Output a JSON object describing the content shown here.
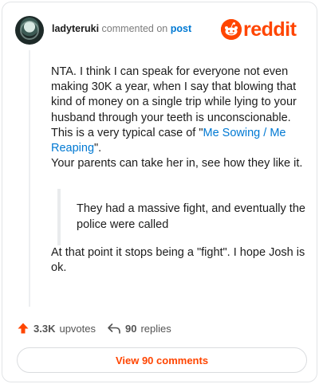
{
  "comment": {
    "username": "ladyteruki",
    "commented_on_text": "commented on",
    "post_link_text": "post"
  },
  "brand": {
    "wordmark": "reddit",
    "color": "#ff4500"
  },
  "body": {
    "para1_text": "NTA. I think I can speak for everyone not even making 30K a year, when I say that blowing that kind of money on a single trip while lying to your husband through your teeth is unconscionable. This is a very typical case of \"",
    "para1_link": "Me Sowing / Me Reaping",
    "para1_end": "\".",
    "para2": "Your parents can take her in, see how they like it.",
    "quote": "They had a massive fight, and eventually the police were called",
    "para3": "At that point it stops being a \"fight\". I hope Josh is ok."
  },
  "actions": {
    "upvotes": "3.3K",
    "upvotes_label": "upvotes",
    "replies": "90",
    "replies_label": "replies"
  },
  "view_comments_label": "View 90 comments"
}
